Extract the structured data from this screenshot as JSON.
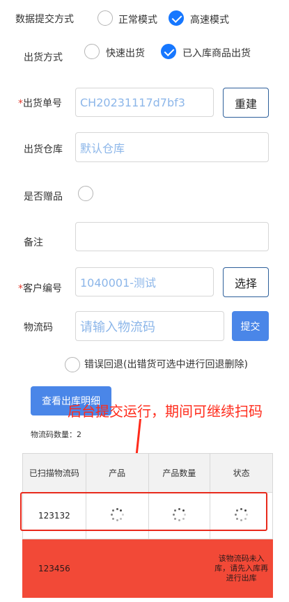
{
  "submit_mode": {
    "label": "数据提交方式",
    "options": [
      {
        "label": "正常模式",
        "selected": false
      },
      {
        "label": "高速模式",
        "selected": true
      }
    ]
  },
  "ship_mode": {
    "label": "出货方式",
    "options": [
      {
        "label": "快速出货",
        "selected": false
      },
      {
        "label": "已入库商品出货",
        "selected": true
      }
    ]
  },
  "order_no": {
    "required_mark": "*",
    "label": "出货单号",
    "value": "CH20231117d7bf3",
    "rebuild_label": "重建"
  },
  "warehouse": {
    "label": "出货仓库",
    "value": "默认仓库"
  },
  "gift": {
    "label": "是否赠品",
    "checked": false
  },
  "remark": {
    "label": "备注",
    "value": ""
  },
  "customer": {
    "required_mark": "*",
    "label": "客户编号",
    "value": "1040001-测试",
    "select_label": "选择"
  },
  "logistics": {
    "label": "物流码",
    "placeholder": "请输入物流码",
    "submit_label": "提交"
  },
  "rollback": {
    "label": "错误回退(出错货可选中进行回退删除)",
    "checked": false
  },
  "detail_button": {
    "label": "查看出库明细"
  },
  "annotation": {
    "text": "后台提交运行，期间可继续扫码"
  },
  "count": {
    "label": "物流码数量：",
    "value": "2"
  },
  "table": {
    "headers": [
      "已扫描物流码",
      "产品",
      "产品数量",
      "状态"
    ],
    "rows": [
      {
        "code": "123132",
        "loading": true,
        "status": ""
      },
      {
        "code": "123456",
        "loading": false,
        "status": "该物流码未入库，请先入库再进行出库"
      }
    ]
  },
  "colors": {
    "accent": "#1677ff",
    "button_blue": "#4a86e8",
    "error_row": "#f24937",
    "annotation": "#ff2a1a"
  }
}
